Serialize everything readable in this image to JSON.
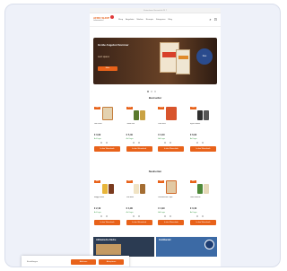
{
  "site": {
    "topbar": "Kostenloser Versand ab 29 €",
    "logo_line1": "AFRO SHOP",
    "logo_line2": "Lebensmittel",
    "nav": [
      "Shop",
      "Angebote",
      "Marken",
      "Rezepte",
      "Kategorien",
      "Blog"
    ],
    "icons": [
      "search-icon",
      "cart-icon"
    ]
  },
  "hero": {
    "title": "Große Angebot Sommer",
    "subtitle": "Jetzt sparen",
    "cta": "Mehr",
    "badge": "Neu"
  },
  "section1": {
    "title": "Bestseller",
    "products": [
      {
        "tag": "-10%",
        "name": "Gari Weiß",
        "price": "€ 3,99",
        "stock": "Auf Lager",
        "btn": "In den Warenkorb"
      },
      {
        "tag": "-10%",
        "name": "Palmöl Rot",
        "price": "€ 5,49",
        "stock": "Auf Lager",
        "btn": "In den Warenkorb"
      },
      {
        "tag": "-10%",
        "name": "Fufu Mehl",
        "price": "€ 4,29",
        "stock": "Auf Lager",
        "btn": "In den Warenkorb"
      },
      {
        "tag": "-10%",
        "name": "Egusi Samen",
        "price": "€ 6,99",
        "stock": "Auf Lager",
        "btn": "In den Warenkorb"
      }
    ]
  },
  "section2": {
    "title": "Neuheiten",
    "products": [
      {
        "tag": "Neu",
        "name": "Maggi Würze",
        "price": "€ 2,49",
        "stock": "Auf Lager",
        "btn": "In den Warenkorb"
      },
      {
        "tag": "Neu",
        "name": "Yam Mehl",
        "price": "€ 4,99",
        "stock": "Auf Lager",
        "btn": "In den Warenkorb"
      },
      {
        "tag": "Neu",
        "name": "Kochbanane Chips",
        "price": "€ 1,99",
        "stock": "Auf Lager",
        "btn": "In den Warenkorb"
      },
      {
        "tag": "Neu",
        "name": "Jollof Gewürz",
        "price": "€ 3,49",
        "stock": "Auf Lager",
        "btn": "In den Warenkorb"
      }
    ]
  },
  "banners": {
    "left": "Afrikanische Küche",
    "right": "Großhandel"
  },
  "cookie": {
    "link": "Einstellungen",
    "accept": "Akzeptieren",
    "reject": "Ablehnen"
  },
  "colors": {
    "accent": "#e8621a",
    "frame": "#eef1f9"
  }
}
